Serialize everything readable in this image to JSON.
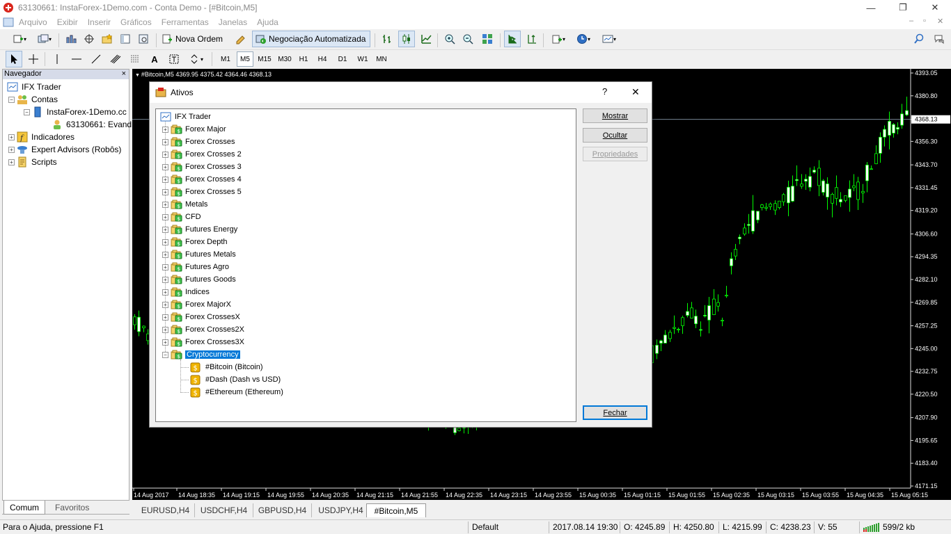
{
  "window": {
    "title": "63130661: InstaForex-1Demo.com - Conta Demo - [#Bitcoin,M5]"
  },
  "menu": [
    "Arquivo",
    "Exibir",
    "Inserir",
    "Gráficos",
    "Ferramentas",
    "Janelas",
    "Ajuda"
  ],
  "toolbar": {
    "new_order_label": "Nova Ordem",
    "auto_trading_label": "Negociação Automatizada"
  },
  "periods": [
    "M1",
    "M5",
    "M15",
    "M30",
    "H1",
    "H4",
    "D1",
    "W1",
    "MN"
  ],
  "active_period": "M5",
  "navigator": {
    "title": "Navegador",
    "close": "×",
    "root": "IFX Trader",
    "accounts": "Contas",
    "server": "InstaForex-1Demo.cc",
    "account": "63130661: Evandr",
    "indicators": "Indicadores",
    "experts": "Expert Advisors (Robôs)",
    "scripts": "Scripts",
    "tabs": [
      "Comum",
      "Favoritos"
    ]
  },
  "chart": {
    "header": "#Bitcoin,M5  4369.95 4375.42 4364.46 4368.13",
    "price_levels": [
      "4393.05",
      "4380.80",
      "4368.13",
      "4356.30",
      "4343.70",
      "4331.45",
      "4319.20",
      "4306.60",
      "4294.35",
      "4282.10",
      "4269.85",
      "4257.25",
      "4245.00",
      "4232.75",
      "4220.50",
      "4207.90",
      "4195.65",
      "4183.40",
      "4171.15"
    ],
    "current_price": "4368.13",
    "time_labels": [
      "14 Aug 2017",
      "14 Aug 18:35",
      "14 Aug 19:15",
      "14 Aug 19:55",
      "14 Aug 20:35",
      "14 Aug 21:15",
      "14 Aug 21:55",
      "14 Aug 22:35",
      "14 Aug 23:15",
      "14 Aug 23:55",
      "15 Aug 00:35",
      "15 Aug 01:15",
      "15 Aug 01:55",
      "15 Aug 02:35",
      "15 Aug 03:15",
      "15 Aug 03:55",
      "15 Aug 04:35",
      "15 Aug 05:15"
    ],
    "colors": {
      "background": "#000000",
      "candle": "#00ff00",
      "bull_body": "#ffffff",
      "bear_body": "#000000",
      "axis_text": "#ffffff"
    }
  },
  "chart_data": {
    "type": "candlestick",
    "title": "#Bitcoin,M5",
    "ylim": [
      4171.15,
      4393.05
    ],
    "last": {
      "open": 4369.95,
      "high": 4375.42,
      "low": 4364.46,
      "close": 4368.13
    }
  },
  "chart_tabs": [
    "EURUSD,H4",
    "USDCHF,H4",
    "GBPUSD,H4",
    "USDJPY,H4",
    "#Bitcoin,M5"
  ],
  "active_chart_tab": "#Bitcoin,M5",
  "dialog": {
    "title": "Ativos",
    "help": "?",
    "close": "✕",
    "root": "IFX Trader",
    "groups": [
      "Forex Major",
      "Forex Crosses",
      "Forex Crosses 2",
      "Forex Crosses 3",
      "Forex Crosses 4",
      "Forex Crosses 5",
      "Metals",
      "CFD",
      "Futures Energy",
      "Forex Depth",
      "Futures Metals",
      "Futures Agro",
      "Futures Goods",
      "Indices",
      "Forex MajorX",
      "Forex CrossesX",
      "Forex Crosses2X",
      "Forex Crosses3X",
      "Cryptocurrency"
    ],
    "selected_group": "Cryptocurrency",
    "symbols": [
      "#Bitcoin  (Bitcoin)",
      "#Dash  (Dash vs USD)",
      "#Ethereum  (Ethereum)"
    ],
    "buttons": {
      "show": "Mostrar",
      "hide": "Ocultar",
      "properties": "Propriedades",
      "close": "Fechar"
    }
  },
  "status": {
    "help": "Para o Ajuda, pressione F1",
    "profile": "Default",
    "datetime": "2017.08.14 19:30",
    "open": "O: 4245.89",
    "high": "H: 4250.80",
    "low": "L: 4215.99",
    "close": "C: 4238.23",
    "volume": "V: 55",
    "traffic": "599/2 kb"
  }
}
